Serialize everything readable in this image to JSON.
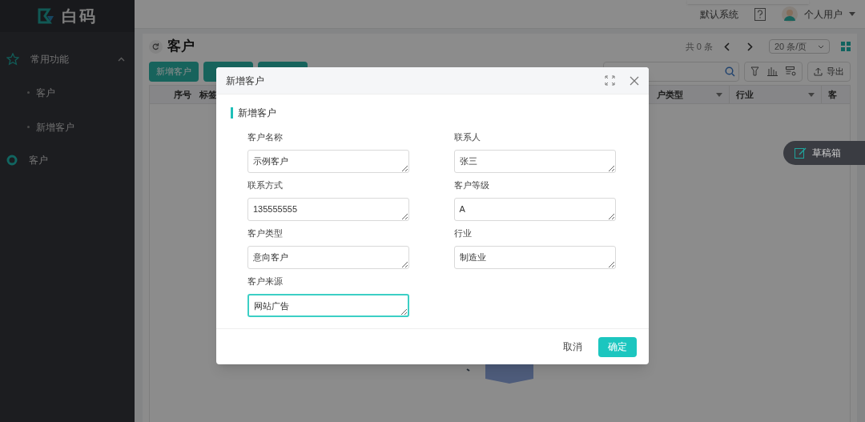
{
  "sidebar": {
    "logo": "白码",
    "groups": [
      {
        "label": "常用功能",
        "expanded": true,
        "children": [
          {
            "label": "客户"
          },
          {
            "label": "新增客户"
          }
        ]
      },
      {
        "label": "客户"
      }
    ]
  },
  "header": {
    "system": "默认系统",
    "user": "个人用户"
  },
  "page": {
    "title": "客户",
    "total": "共 0 条",
    "page_size": "20 条/页",
    "toolbar": [
      {
        "label": "新增客户"
      }
    ],
    "export": "导出",
    "columns": [
      {
        "label": "序号"
      },
      {
        "label": "标签"
      },
      {
        "label": "户类型"
      },
      {
        "label": "行业"
      },
      {
        "label": "客"
      }
    ]
  },
  "drafts": "草稿箱",
  "dialog": {
    "title": "新增客户",
    "section": "新增客户",
    "fields": [
      {
        "label": "客户名称",
        "value": "示例客户",
        "focused": false
      },
      {
        "label": "联系人",
        "value": "张三",
        "focused": false
      },
      {
        "label": "联系方式",
        "value": "135555555",
        "focused": false
      },
      {
        "label": "客户等级",
        "value": "A",
        "focused": false
      },
      {
        "label": "客户类型",
        "value": "意向客户",
        "focused": false
      },
      {
        "label": "行业",
        "value": "制造业",
        "focused": false
      },
      {
        "label": "客户来源",
        "value": "网站广告",
        "focused": true
      }
    ],
    "cancel": "取消",
    "confirm": "确定"
  }
}
